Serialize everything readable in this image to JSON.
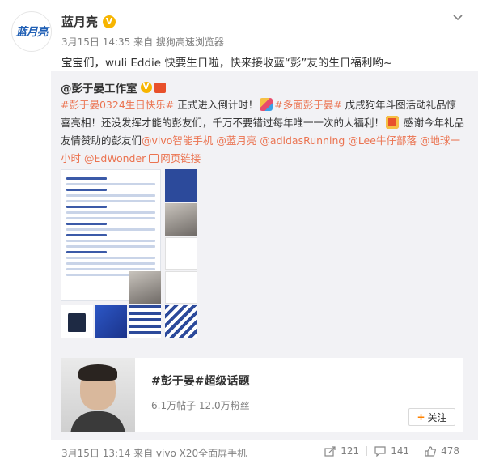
{
  "post": {
    "author": "蓝月亮",
    "logo_text": "蓝月亮",
    "verified": "V",
    "meta": "3月15日 14:35 来自 搜狗高速浏览器",
    "text": "宝宝们，wuli Eddie 快要生日啦，快来接收蓝“彭”友的生日福利哟~"
  },
  "retweet": {
    "author": "@彭于晏工作室",
    "verified": "V",
    "segments": [
      {
        "t": "#彭于晏0324生日快乐#",
        "hl": true
      },
      {
        "t": " 正式进入倒计时！",
        "hl": false
      },
      {
        "emoji": "party"
      },
      {
        "t": "#多面彭于晏#",
        "hl": true
      },
      {
        "t": " 戊戌狗年斗图活动礼品惊喜亮相！还没发挥才能的彭友们，千万不要错过每年唯一一次的大福利！",
        "hl": false
      },
      {
        "emoji": "gift"
      },
      {
        "t": " 感谢今年礼品友情赞助的彭友们",
        "hl": false
      },
      {
        "t": "@vivo智能手机",
        "hl": true
      },
      {
        "t": " ",
        "hl": false
      },
      {
        "t": "@蓝月亮",
        "hl": true
      },
      {
        "t": " ",
        "hl": false
      },
      {
        "t": "@adidasRunning",
        "hl": true
      },
      {
        "t": " ",
        "hl": false
      },
      {
        "t": "@Lee牛仔部落",
        "hl": true
      },
      {
        "t": " ",
        "hl": false
      },
      {
        "t": "@地球一小时",
        "hl": true
      },
      {
        "t": " ",
        "hl": false
      },
      {
        "t": "@EdWonder",
        "hl": true
      },
      {
        "link": "网页链接"
      }
    ]
  },
  "topic": {
    "title": "#彭于晏#超级话题",
    "stats": "6.1万帖子  12.0万粉丝",
    "follow_label": "关注",
    "follow_plus": "+"
  },
  "footer": {
    "meta": "3月15日 13:14 来自 vivo X20全面屏手机",
    "share": "121",
    "comment": "141",
    "like": "478"
  },
  "colors": {
    "link": "#eb7350",
    "accent": "#ff8200",
    "brand_blue": "#2c4a9b"
  }
}
